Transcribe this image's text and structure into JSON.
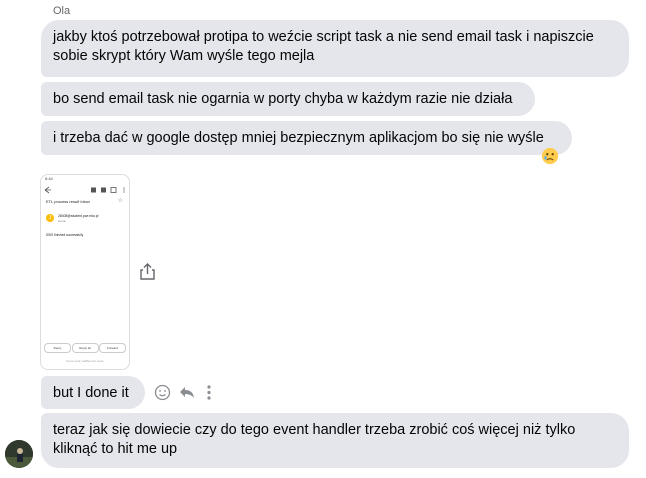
{
  "sender_name": "Ola",
  "messages": [
    {
      "text": "jakby ktoś potrzebował protipa to weźcie script task a nie send email task i napiszcie\nsobie skrypt który Wam wyśle tego mejla"
    },
    {
      "text": "bo send email task nie ogarnia w porty chyba w każdym razie nie działa"
    },
    {
      "text": "i trzeba dać w google dostęp mniej bezpiecznym aplikacjom bo się nie wyśle"
    },
    {
      "text": "but I done it"
    },
    {
      "text": "teraz jak się dowiecie czy do tego event handler trzeba zrobić coś więcej niż tylko\nkliknąć to hit me up"
    }
  ],
  "reaction": {
    "icon": "sad-face-emoji"
  },
  "attachment": {
    "status_time": "6:44",
    "subject": "ETL process result",
    "badge": "Inbox",
    "avatar_letter": "J",
    "from": "28408@student.pwr.edu.pl",
    "to": "to me",
    "body": "SSIS finished successfully",
    "buttons": [
      "Reply",
      "Reply all",
      "Forward"
    ],
    "footer": "Go to your mailbox for more"
  },
  "actions": [
    "react-icon",
    "reply-icon",
    "more-icon"
  ],
  "colors": {
    "bubble": "#e4e6eb",
    "text": "#050505",
    "meta": "#65676b"
  }
}
